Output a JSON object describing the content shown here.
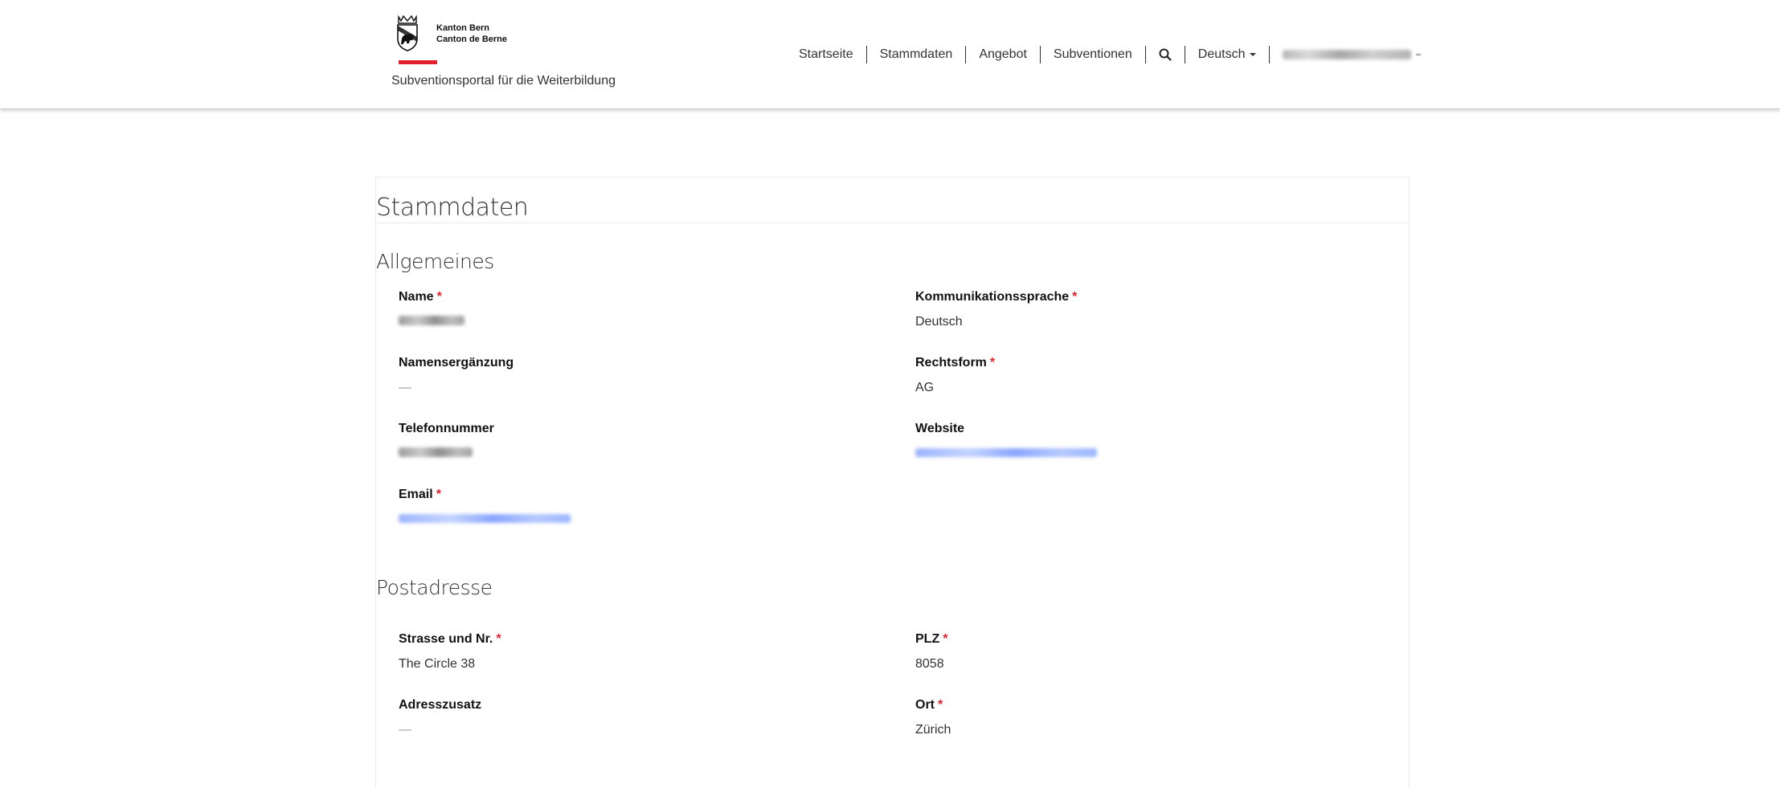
{
  "header": {
    "logo_line1": "Kanton Bern",
    "logo_line2": "Canton de Berne",
    "portal_title": "Subventionsportal für die Weiterbildung",
    "nav": {
      "home": "Startseite",
      "master_data": "Stammdaten",
      "offer": "Angebot",
      "subsidies": "Subventionen",
      "search_icon": "search-icon",
      "language": "Deutsch"
    },
    "accent_color": "#e3222d"
  },
  "page": {
    "title": "Stammdaten",
    "sections": {
      "general": {
        "title": "Allgemeines",
        "name_label": "Name",
        "name_suffix_label": "Namensergänzung",
        "name_suffix_value": "—",
        "phone_label": "Telefonnummer",
        "email_label": "Email",
        "language_label": "Kommunikationssprache",
        "language_value": "Deutsch",
        "legal_form_label": "Rechtsform",
        "legal_form_value": "AG",
        "website_label": "Website"
      },
      "postal": {
        "title": "Postadresse",
        "street_label": "Strasse und Nr.",
        "street_value": "The Circle 38",
        "address_extra_label": "Adresszusatz",
        "address_extra_value": "—",
        "zip_label": "PLZ",
        "zip_value": "8058",
        "city_label": "Ort",
        "city_value": "Zürich"
      }
    },
    "required_marker": "*"
  }
}
